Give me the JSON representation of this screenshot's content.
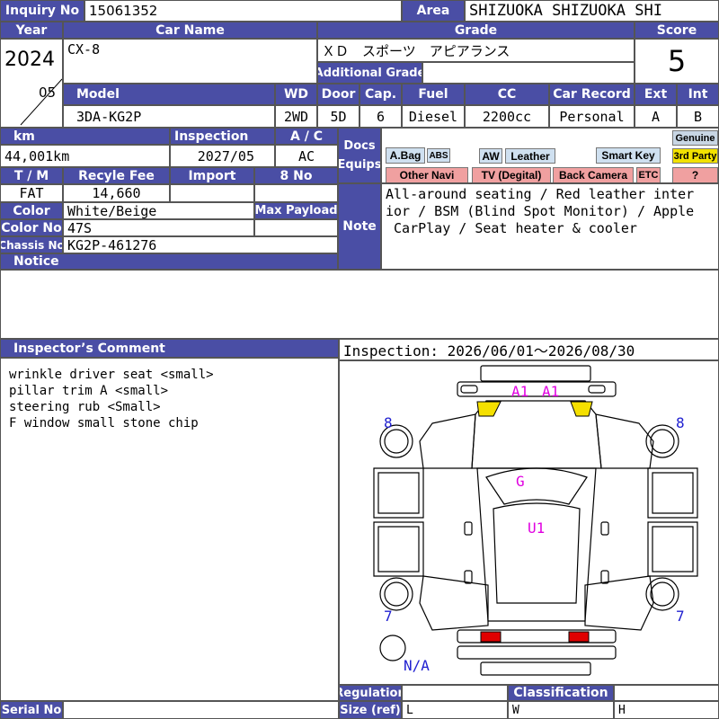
{
  "header": {
    "inquiry_label": "Inquiry No",
    "inquiry_value": "15061352",
    "area_label": "Area",
    "area_value": "SHIZUOKA SHIZUOKA SHI"
  },
  "row1_labels": {
    "year": "Year",
    "car_name": "Car Name",
    "grade": "Grade",
    "score": "Score"
  },
  "vehicle": {
    "year": "2024",
    "month": "05",
    "car_name": "CX-8",
    "grade": "ＸＤ　スポーツ　アピアランス",
    "additional_grade_label": "Additional Grade",
    "additional_grade_value": "",
    "score": "5"
  },
  "row2_labels": {
    "model": "Model",
    "wd": "WD",
    "door": "Door",
    "cap": "Cap.",
    "fuel": "Fuel",
    "cc": "CC",
    "car_record": "Car Record",
    "ext": "Ext",
    "int": "Int"
  },
  "row2_values": {
    "model": "3DA-KG2P",
    "wd": "2WD",
    "door": "5D",
    "cap": "6",
    "fuel": "Diesel",
    "cc": "2200cc",
    "car_record": "Personal",
    "ext": "A",
    "int": "B"
  },
  "row3_labels": {
    "km": "km",
    "inspection": "Inspection",
    "ac": "A / C",
    "docs": "Docs",
    "equips": "Equips"
  },
  "row3_values": {
    "km": "44,001km",
    "inspection": "2027/05",
    "ac": "AC"
  },
  "equips": {
    "abag": "A.Bag",
    "abs": "ABS",
    "aw": "AW",
    "leather": "Leather",
    "smart_key": "Smart Key",
    "genuine": "Genuine",
    "third_party": "3rd Party",
    "other_navi": "Other Navi",
    "tv": "TV (Degital)",
    "back_camera": "Back Camera",
    "etc": "ETC",
    "question": "?"
  },
  "row4_labels": {
    "tm": "T / M",
    "recycle": "Recyle Fee",
    "import": "Import",
    "eight_no": "8 No"
  },
  "row4_values": {
    "tm": "FAT",
    "recycle": "14,660"
  },
  "row5_labels": {
    "color": "Color",
    "max_payload": "Max Payload",
    "color_no": "Color No",
    "chassis_no": "Chassis No",
    "notice": "Notice",
    "note": "Note"
  },
  "row5_values": {
    "color": "White/Beige",
    "color_no": "47S",
    "chassis_no": "KG2P-461276"
  },
  "note_text": "All-around seating / Red leather inter\nior / BSM (Blind Spot Monitor) / Apple\n CarPlay / Seat heater & cooler",
  "inspector": {
    "label": "Inspector’s Comment",
    "comment": "wrinkle driver seat <small>\npillar trim A <small>\nsteering rub <Small>\nF window small stone chip"
  },
  "inspection_period": "Inspection: 2026/06/01～2026/08/30",
  "diagram_marks": {
    "a1_left": "A1",
    "a1_right": "A1",
    "g": "G",
    "u1": "U1",
    "fl": "8",
    "fr": "8",
    "rl": "7",
    "rr": "7",
    "spare": "N/A",
    "highlight_yellow": "#f5e000",
    "highlight_red": "#e00000"
  },
  "footer": {
    "serial_label": "Serial No",
    "regulation_label": "Regulation",
    "classification_label": "Classification",
    "size_label": "Size (ref)",
    "size_l": "L",
    "size_w": "W",
    "size_h": "H"
  }
}
